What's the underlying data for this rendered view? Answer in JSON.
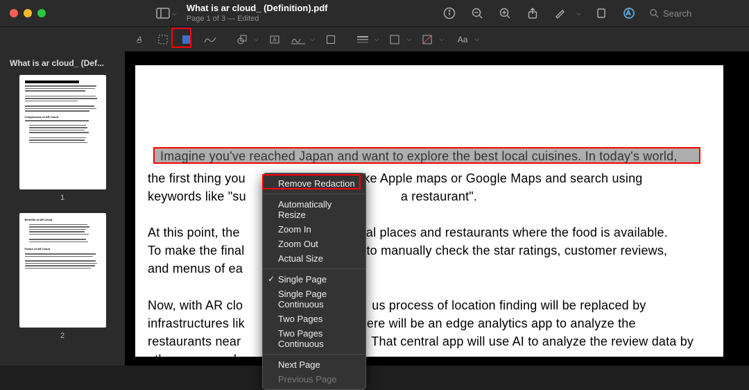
{
  "titlebar": {
    "doc_title": "What is ar cloud_ (Definition).pdf",
    "doc_sub": "Page 1 of 3 — Edited",
    "search_placeholder": "Search"
  },
  "sidebar": {
    "title": "What is ar cloud_ (Def...",
    "thumbs": [
      {
        "num": "1"
      },
      {
        "num": "2"
      }
    ]
  },
  "pdf": {
    "highlight_line": "Imagine you've reached Japan and want to explore the best local cuisines. In today's world,",
    "line2_pre": "the first thing you",
    "line2_post": "like Apple maps or Google Maps and search using",
    "line3_pre": "keywords like \"su",
    "line3_post": "a restaurant\".",
    "p2_pre1": "At this point, the",
    "p2_post1": "ral places and restaurants where the food is available.",
    "p2_pre2": "To make the final",
    "p2_post2": "to manually check the star ratings, customer reviews,",
    "p2_last": "and menus of ea",
    "p3_pre1": "Now, with AR clo",
    "p3_post1": "us process of location finding will be replaced by",
    "p3_pre2": "infrastructures lik",
    "p3_post2": "ere will be an edge analytics app to analyze the",
    "p3_pre3": "restaurants near",
    "p3_post3": "That central app will use AI to analyze the review data by",
    "p3_last": "other users and suggest you the best ones."
  },
  "context_menu": {
    "items": [
      {
        "label": "Remove Redaction",
        "enabled": true,
        "check": false
      },
      {
        "label": "Automatically Resize",
        "enabled": true,
        "check": false
      },
      {
        "label": "Zoom In",
        "enabled": true,
        "check": false
      },
      {
        "label": "Zoom Out",
        "enabled": true,
        "check": false
      },
      {
        "label": "Actual Size",
        "enabled": true,
        "check": false
      },
      {
        "label": "Single Page",
        "enabled": true,
        "check": true
      },
      {
        "label": "Single Page Continuous",
        "enabled": true,
        "check": false
      },
      {
        "label": "Two Pages",
        "enabled": true,
        "check": false
      },
      {
        "label": "Two Pages Continuous",
        "enabled": true,
        "check": false
      },
      {
        "label": "Next Page",
        "enabled": true,
        "check": false
      },
      {
        "label": "Previous Page",
        "enabled": false,
        "check": false
      }
    ]
  }
}
